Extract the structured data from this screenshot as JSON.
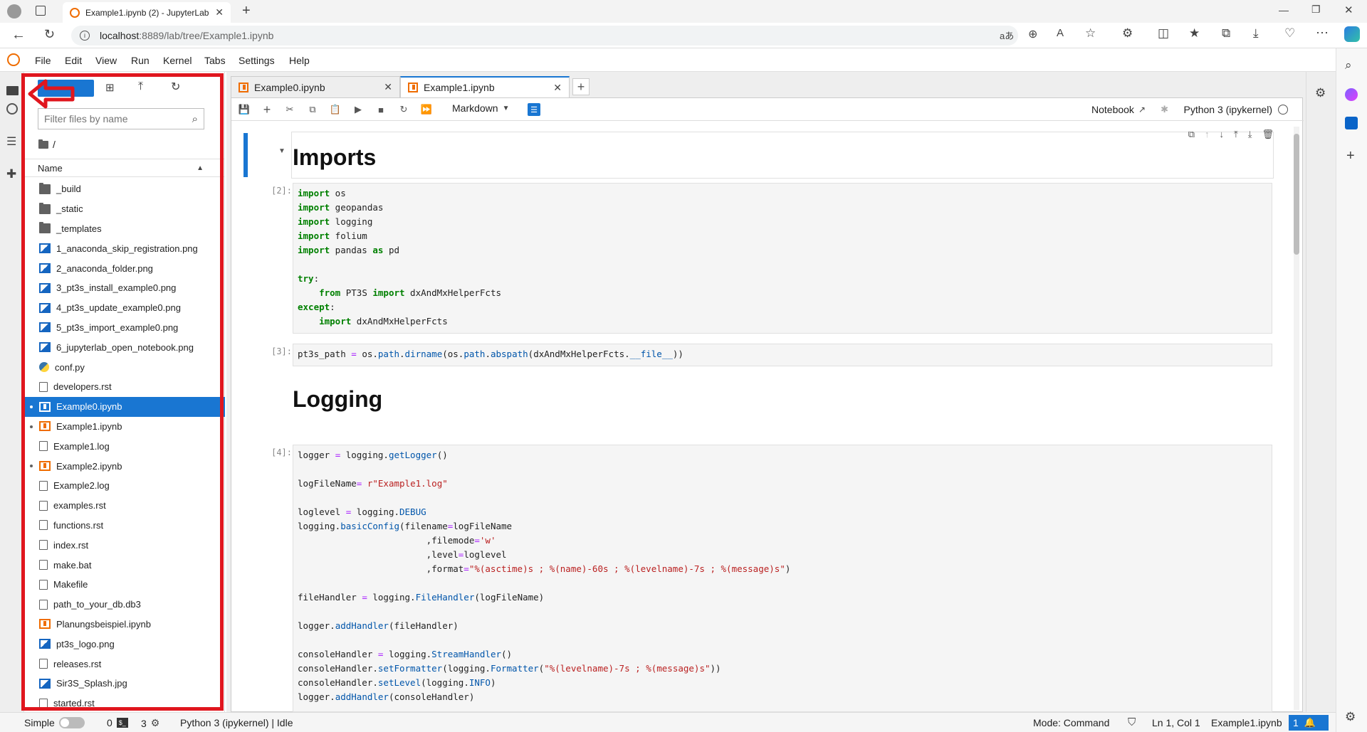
{
  "browser": {
    "tab_title": "Example1.ipynb (2) - JupyterLab",
    "url_host": "localhost",
    "url_rest": ":8889/lab/tree/Example1.ipynb"
  },
  "menu": [
    "File",
    "Edit",
    "View",
    "Run",
    "Kernel",
    "Tabs",
    "Settings",
    "Help"
  ],
  "filebrowser": {
    "filter_placeholder": "Filter files by name",
    "breadcrumb": "/",
    "column_name": "Name",
    "files": [
      {
        "name": "_build",
        "type": "folder",
        "running": false,
        "selected": false
      },
      {
        "name": "_static",
        "type": "folder",
        "running": false,
        "selected": false
      },
      {
        "name": "_templates",
        "type": "folder",
        "running": false,
        "selected": false
      },
      {
        "name": "1_anaconda_skip_registration.png",
        "type": "image",
        "running": false,
        "selected": false
      },
      {
        "name": "2_anaconda_folder.png",
        "type": "image",
        "running": false,
        "selected": false
      },
      {
        "name": "3_pt3s_install_example0.png",
        "type": "image",
        "running": false,
        "selected": false
      },
      {
        "name": "4_pt3s_update_example0.png",
        "type": "image",
        "running": false,
        "selected": false
      },
      {
        "name": "5_pt3s_import_example0.png",
        "type": "image",
        "running": false,
        "selected": false
      },
      {
        "name": "6_jupyterlab_open_notebook.png",
        "type": "image",
        "running": false,
        "selected": false
      },
      {
        "name": "conf.py",
        "type": "py",
        "running": false,
        "selected": false
      },
      {
        "name": "developers.rst",
        "type": "doc",
        "running": false,
        "selected": false
      },
      {
        "name": "Example0.ipynb",
        "type": "nb",
        "running": true,
        "selected": true
      },
      {
        "name": "Example1.ipynb",
        "type": "nb",
        "running": true,
        "selected": false
      },
      {
        "name": "Example1.log",
        "type": "doc",
        "running": false,
        "selected": false
      },
      {
        "name": "Example2.ipynb",
        "type": "nb",
        "running": true,
        "selected": false
      },
      {
        "name": "Example2.log",
        "type": "doc",
        "running": false,
        "selected": false
      },
      {
        "name": "examples.rst",
        "type": "doc",
        "running": false,
        "selected": false
      },
      {
        "name": "functions.rst",
        "type": "doc",
        "running": false,
        "selected": false
      },
      {
        "name": "index.rst",
        "type": "doc",
        "running": false,
        "selected": false
      },
      {
        "name": "make.bat",
        "type": "doc",
        "running": false,
        "selected": false
      },
      {
        "name": "Makefile",
        "type": "doc",
        "running": false,
        "selected": false
      },
      {
        "name": "path_to_your_db.db3",
        "type": "doc",
        "running": false,
        "selected": false
      },
      {
        "name": "Planungsbeispiel.ipynb",
        "type": "nb",
        "running": false,
        "selected": false
      },
      {
        "name": "pt3s_logo.png",
        "type": "image",
        "running": false,
        "selected": false
      },
      {
        "name": "releases.rst",
        "type": "doc",
        "running": false,
        "selected": false
      },
      {
        "name": "Sir3S_Splash.jpg",
        "type": "image",
        "running": false,
        "selected": false
      },
      {
        "name": "started.rst",
        "type": "doc",
        "running": false,
        "selected": false
      }
    ]
  },
  "notebook_tabs": [
    {
      "label": "Example0.ipynb",
      "active": false
    },
    {
      "label": "Example1.ipynb",
      "active": true
    }
  ],
  "toolbar": {
    "cell_type": "Markdown",
    "notebook_label": "Notebook",
    "kernel": "Python 3 (ipykernel)"
  },
  "cells": {
    "h_imports": "Imports",
    "p2": "[2]:",
    "p3": "[3]:",
    "h_logging": "Logging",
    "p4": "[4]:"
  },
  "statusbar": {
    "simple": "Simple",
    "terminals": "0",
    "kernels": "3",
    "kernel_status": "Python 3 (ipykernel) | Idle",
    "mode": "Mode: Command",
    "position": "Ln 1, Col 1",
    "filename": "Example1.ipynb",
    "notifications": "1"
  },
  "colors": {
    "accent": "#1976d2",
    "highlight": "#e0161e"
  }
}
